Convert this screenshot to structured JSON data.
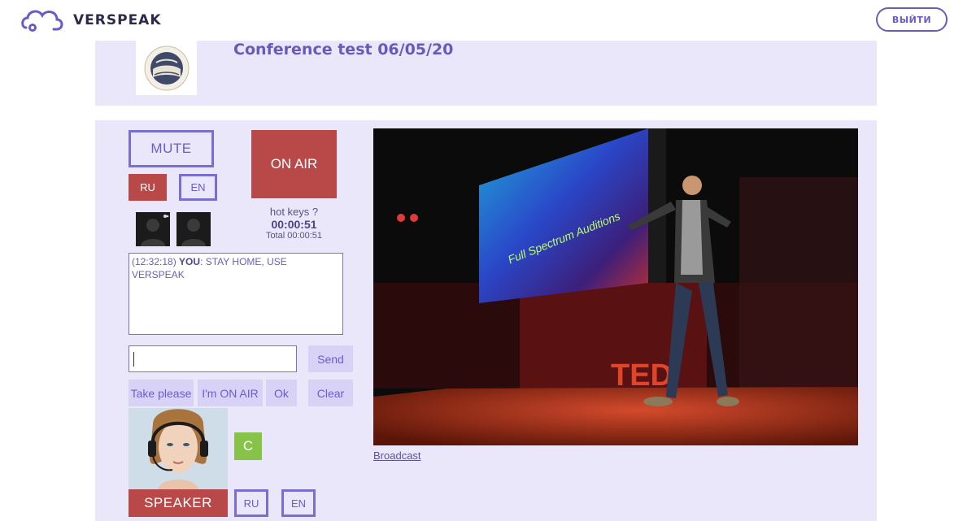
{
  "header": {
    "brand": "VERSPEAK",
    "logout_label": "ВЫЙТИ"
  },
  "conference": {
    "title": "Conference test 06/05/20",
    "logo_icon": "globe-seal-icon"
  },
  "controls": {
    "mute_label": "MUTE",
    "on_air_label": "ON AIR",
    "lang_ru": "RU",
    "lang_en": "EN",
    "hot_keys_label": "hot keys ?",
    "timer": "00:00:51",
    "total": "Total 00:00:51"
  },
  "chat": {
    "time": "(12:32:18)",
    "sender": "YOU",
    "message": ": STAY HOME, USE VERSPEAK",
    "input_value": "",
    "send_label": "Send",
    "quick_replies": [
      "Take please",
      "I'm ON AIR",
      "Ok"
    ],
    "clear_label": "Clear"
  },
  "speaker": {
    "badge": "C",
    "button_label": "SPEAKER",
    "lang_ru": "RU",
    "lang_en": "EN"
  },
  "video": {
    "screen_text": "Full Spectrum Auditions",
    "stage_text": "TED",
    "link_label": "Broadcast"
  },
  "colors": {
    "accent": "#6b5bc5",
    "panel_bg": "#eae7fb",
    "active_red": "#b94848",
    "badge_green": "#86c348"
  }
}
